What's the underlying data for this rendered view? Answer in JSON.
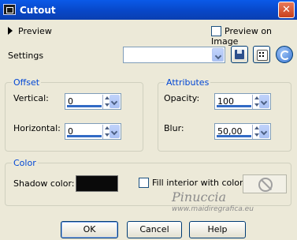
{
  "window": {
    "title": "Cutout",
    "close_glyph": "✕"
  },
  "preview": {
    "label": "Preview",
    "preview_on_image_label": "Preview on Image",
    "preview_on_image_checked": false
  },
  "settings": {
    "label": "Settings",
    "preset_value": ""
  },
  "offset": {
    "title": "Offset",
    "vertical_label": "Vertical:",
    "vertical_value": "0",
    "horizontal_label": "Horizontal:",
    "horizontal_value": "0"
  },
  "attributes": {
    "title": "Attributes",
    "opacity_label": "Opacity:",
    "opacity_value": "100",
    "blur_label": "Blur:",
    "blur_value": "50,00"
  },
  "color": {
    "title": "Color",
    "shadow_color_label": "Shadow color:",
    "shadow_color": "#0a0a0a",
    "fill_interior_label": "Fill interior with color:",
    "fill_interior_checked": false
  },
  "watermark": {
    "name": "Pinuccia",
    "url": "www.maidiregrafica.eu"
  },
  "buttons": {
    "ok": "OK",
    "cancel": "Cancel",
    "help": "Help"
  },
  "icons": [
    "save-icon",
    "randomize-dice-icon",
    "reset-icon",
    "no-color-icon"
  ]
}
